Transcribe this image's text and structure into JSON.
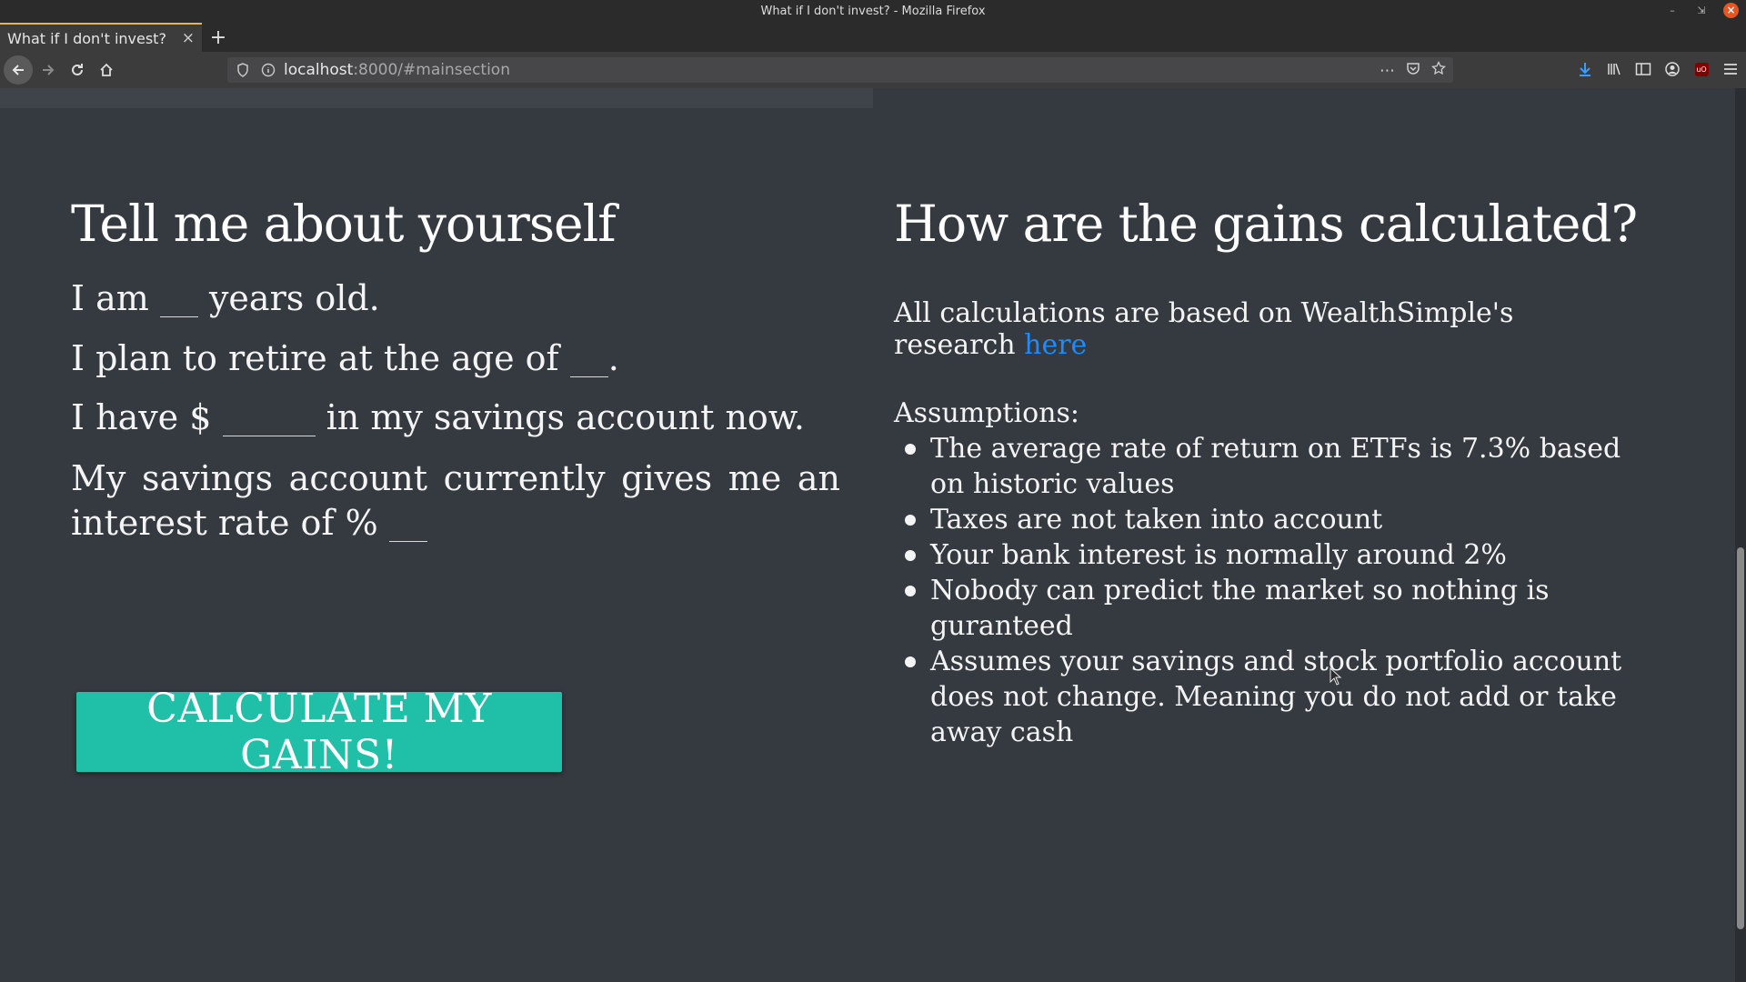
{
  "window": {
    "title": "What if I don't invest? - Mozilla Firefox",
    "minimize_icon": "minimize-icon",
    "maximize_icon": "restore-icon",
    "close_icon": "close-icon"
  },
  "tab": {
    "title": "What if I don't invest?",
    "close": "×",
    "new_tab": "+"
  },
  "urlbar": {
    "host": "localhost",
    "path": ":8000/#mainsection"
  },
  "left": {
    "title": "Tell me about yourself",
    "age_before": "I am",
    "age_after": "years old.",
    "retire_before": "I plan to retire at the age of",
    "retire_after": ".",
    "savings_before": "I have $",
    "savings_after": "in my savings account now.",
    "interest_text": "My savings account currently gives me an interest rate of",
    "interest_symbol": "%",
    "button_label": "CALCULATE MY GAINS!"
  },
  "right": {
    "title": "How are the gains calculated?",
    "research_text": "All calculations are based on WealthSimple's research",
    "research_link": "here",
    "assumptions_title": "Assumptions:",
    "assumptions": [
      "The average rate of return on ETFs is 7.3% based on historic values",
      "Taxes are not taken into account",
      "Your bank interest is normally around 2%",
      "Nobody can predict the market so nothing is guranteed",
      "Assumes your savings and stock portfolio account does not change. Meaning you do not add or take away cash"
    ]
  },
  "colors": {
    "background": "#343a40",
    "button": "#20c0a8",
    "link": "#1f8bff",
    "tab_accent": "#e5b25d"
  }
}
